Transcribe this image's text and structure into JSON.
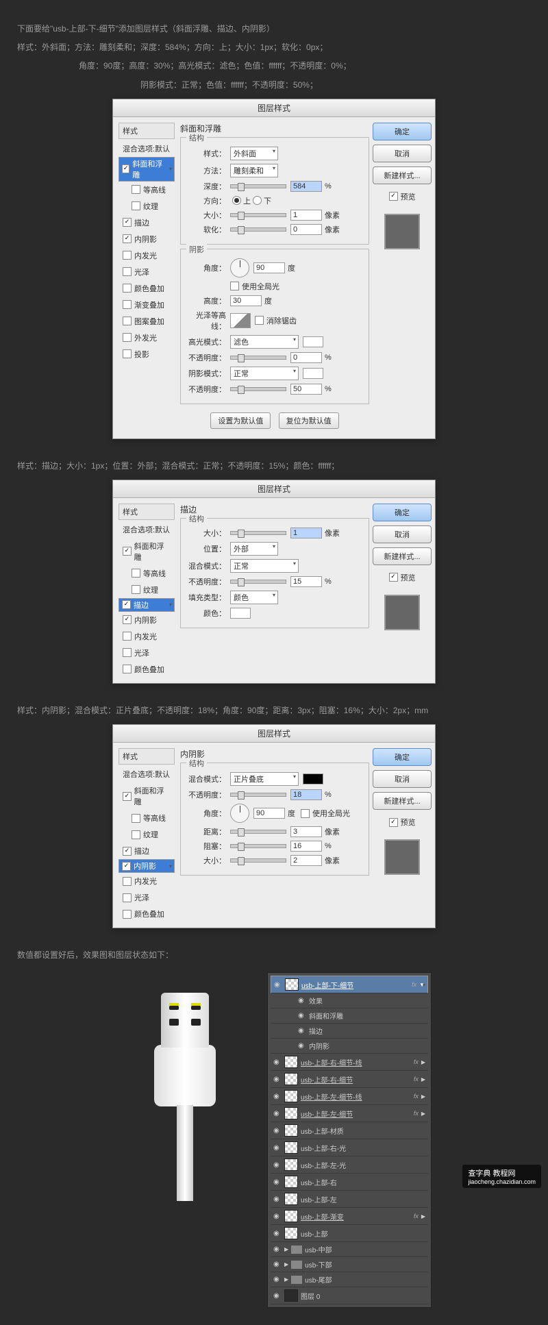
{
  "intro": {
    "line1": "下面要给\"usb-上部-下-细节\"添加图层样式（斜面浮雕、描边、内阴影）",
    "line2": "样式：外斜面；方法：雕刻柔和；深度：584%；方向：上；大小：1px；软化：0px；",
    "line3": "角度：90度；高度：30%；高光模式：滤色；色值：ffffff；不透明度：0%；",
    "line4": "阴影模式：正常；色值：ffffff；不透明度：50%；"
  },
  "dlg_title": "图层样式",
  "styles_header": "样式",
  "blend_opts": "混合选项:默认",
  "style_list": {
    "bevel": "斜面和浮雕",
    "contour": "等高线",
    "texture": "纹理",
    "stroke": "描边",
    "inner_shadow": "内阴影",
    "inner_glow": "内发光",
    "satin": "光泽",
    "color_ol": "颜色叠加",
    "grad_ol": "渐变叠加",
    "pat_ol": "图案叠加",
    "outer_glow": "外发光",
    "drop_shadow": "投影"
  },
  "btns": {
    "ok": "确定",
    "cancel": "取消",
    "new_style": "新建样式...",
    "preview": "预览",
    "defaults": "设置为默认值",
    "reset": "复位为默认值"
  },
  "bevel": {
    "title": "斜面和浮雕",
    "struct": "结构",
    "style_lbl": "样式：",
    "style_val": "外斜面",
    "method_lbl": "方法：",
    "method_val": "雕刻柔和",
    "depth_lbl": "深度：",
    "depth_val": "584",
    "depth_unit": "%",
    "dir_lbl": "方向：",
    "up": "上",
    "down": "下",
    "size_lbl": "大小：",
    "size_val": "1",
    "px": "像素",
    "soften_lbl": "软化：",
    "soften_val": "0",
    "shading": "阴影",
    "angle_lbl": "角度：",
    "angle_val": "90",
    "deg": "度",
    "global": "使用全局光",
    "alt_lbl": "高度：",
    "alt_val": "30",
    "gloss_lbl": "光泽等高线：",
    "anti": "消除锯齿",
    "hl_mode_lbl": "高光模式：",
    "hl_mode_val": "滤色",
    "opacity_lbl": "不透明度：",
    "hl_op_val": "0",
    "sh_mode_lbl": "阴影模式：",
    "sh_mode_val": "正常",
    "sh_op_val": "50"
  },
  "stroke_desc": "样式：描边；大小：1px；位置：外部；混合模式：正常；不透明度：15%；颜色：ffffff；",
  "stroke": {
    "title": "描边",
    "struct": "结构",
    "size_lbl": "大小：",
    "size_val": "1",
    "px": "像素",
    "pos_lbl": "位置：",
    "pos_val": "外部",
    "blend_lbl": "混合模式：",
    "blend_val": "正常",
    "op_lbl": "不透明度：",
    "op_val": "15",
    "unit": "%",
    "fill_lbl": "填充类型：",
    "fill_val": "颜色",
    "color_lbl": "颜色："
  },
  "ishadow_desc": "样式：内阴影；混合模式：正片叠底；不透明度：18%；角度：90度；距离：3px；阻塞：16%；大小：2px；mm",
  "ishadow": {
    "title": "内阴影",
    "struct": "结构",
    "blend_lbl": "混合模式：",
    "blend_val": "正片叠底",
    "op_lbl": "不透明度：",
    "op_val": "18",
    "unit": "%",
    "angle_lbl": "角度：",
    "angle_val": "90",
    "deg": "度",
    "global": "使用全局光",
    "dist_lbl": "距离：",
    "dist_val": "3",
    "px": "像素",
    "choke_lbl": "阻塞：",
    "choke_val": "16",
    "size_lbl": "大小：",
    "size_val": "2"
  },
  "result_desc": "数值都设置好后，效果图和图层状态如下：",
  "layers": {
    "l1": "usb-上部-下-细节",
    "fx": "效果",
    "fx1": "斜面和浮雕",
    "fx2": "描边",
    "fx3": "内阴影",
    "l2": "usb-上部-右-细节-线",
    "l3": "usb-上部-右-细节",
    "l4": "usb-上部-左-细节-线",
    "l5": "usb-上部-左-细节",
    "l6": "usb-上部-材质",
    "l7": "usb-上部-右-光",
    "l8": "usb-上部-左-光",
    "l9": "usb-上部-右",
    "l10": "usb-上部-左",
    "l11": "usb-上部-渐变",
    "l12": "usb-上部",
    "l13": "usb-中部",
    "l14": "usb-下部",
    "l15": "usb-尾部",
    "l16": "图层 0"
  },
  "watermark": {
    "t1": "查字典 教程网",
    "t2": "jiaocheng.chazidian.com"
  }
}
